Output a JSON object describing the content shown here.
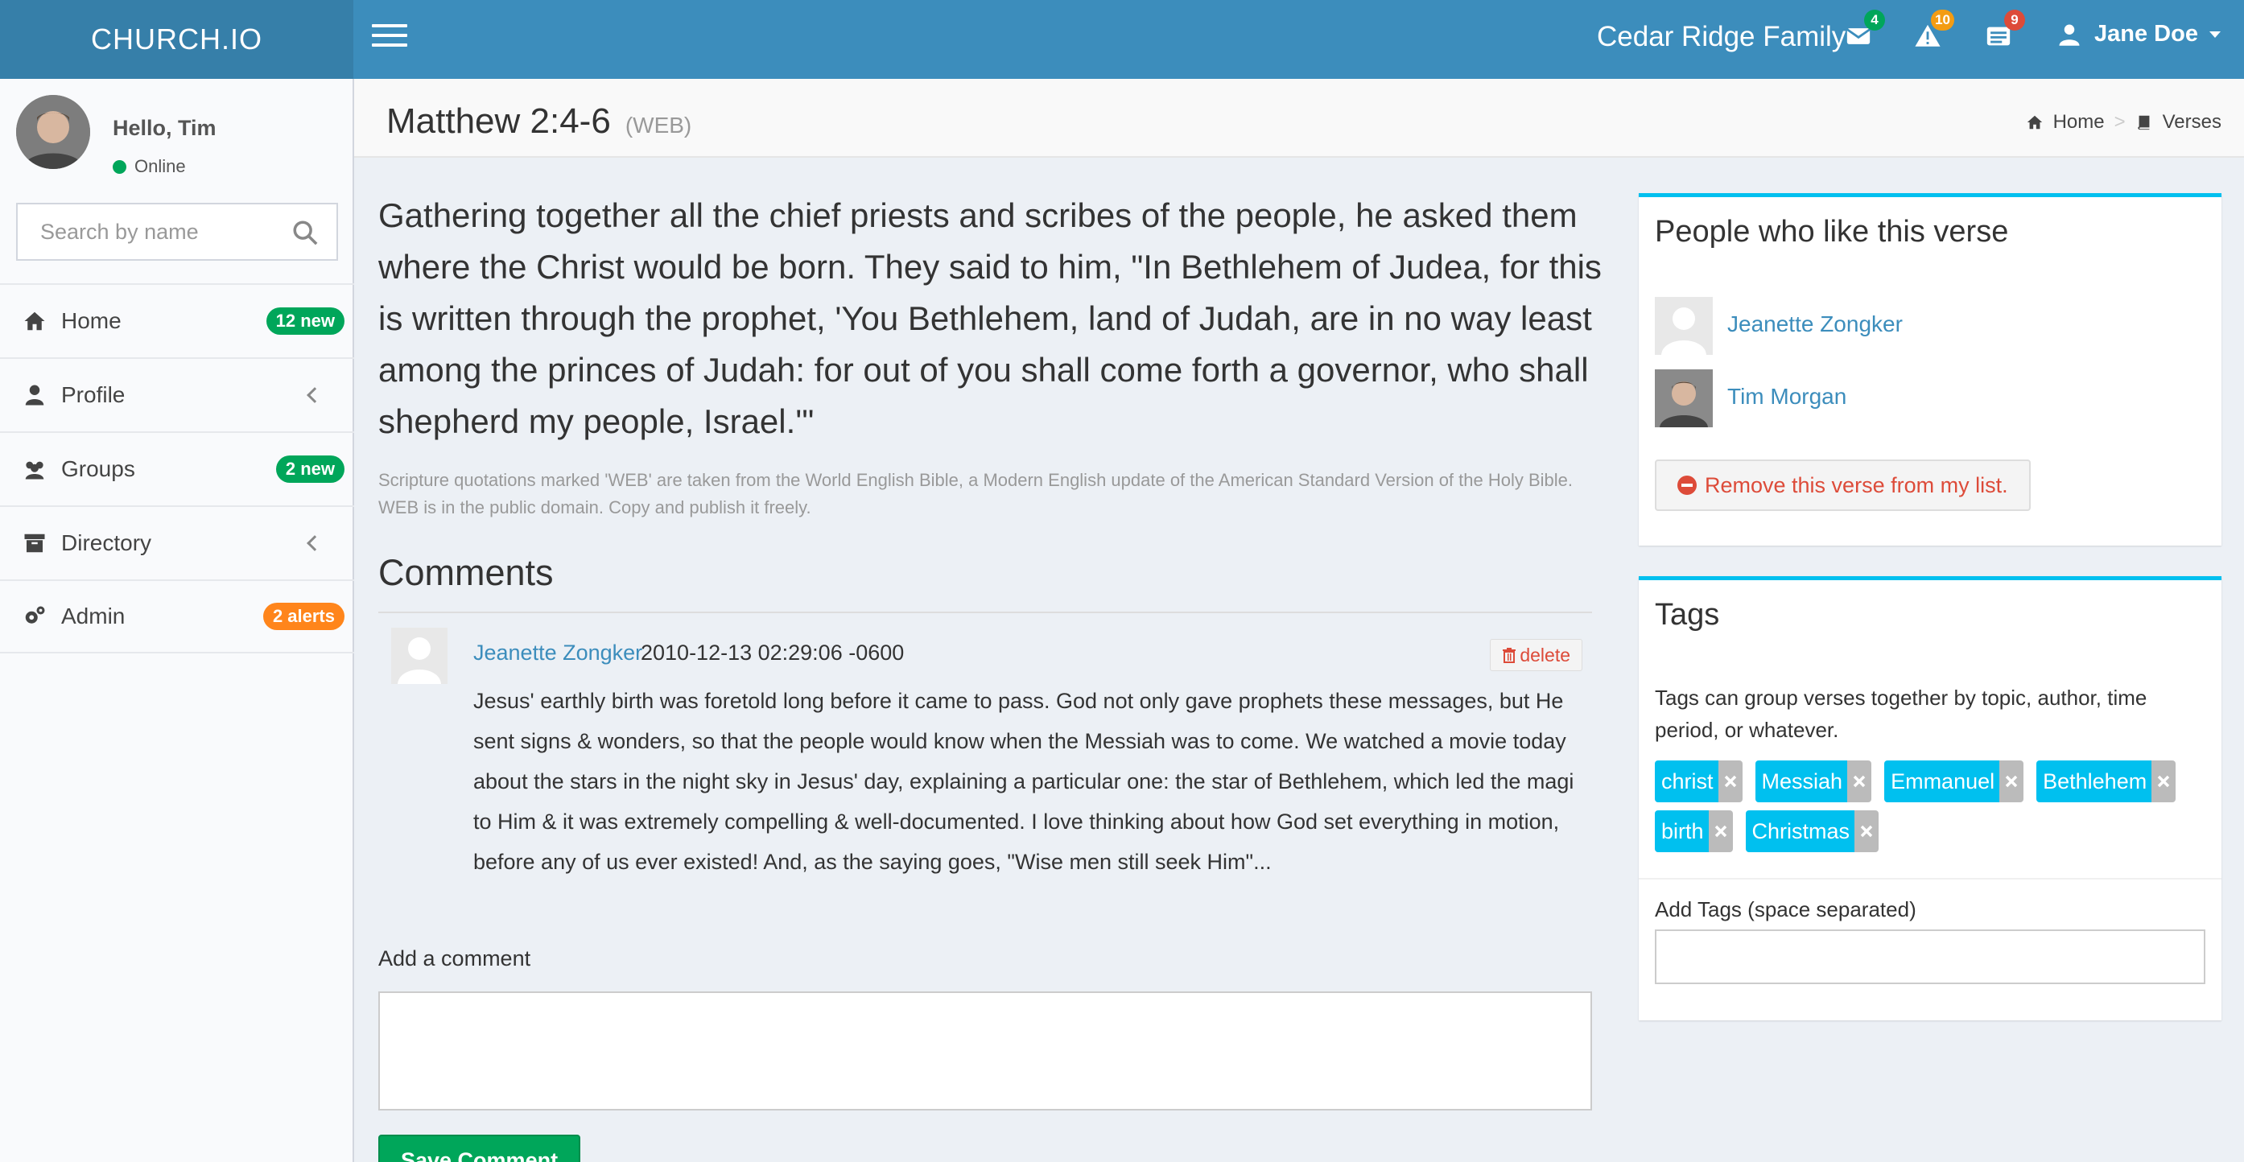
{
  "app": {
    "logo": "CHURCH.IO",
    "org_name": "Cedar Ridge Family",
    "user_name": "Jane Doe"
  },
  "notifications": [
    {
      "icon": "envelope-icon",
      "count": "4",
      "color": "#00a65a"
    },
    {
      "icon": "warning-icon",
      "count": "10",
      "color": "#f39c12"
    },
    {
      "icon": "list-icon",
      "count": "9",
      "color": "#dd4b39"
    }
  ],
  "sidebar": {
    "greeting": "Hello, Tim",
    "status": "Online",
    "search_placeholder": "Search by name",
    "items": [
      {
        "label": "Home",
        "icon": "home-icon",
        "badge": "12 new",
        "badge_color": "#00a65a"
      },
      {
        "label": "Profile",
        "icon": "user-icon",
        "badge": "",
        "has_submenu": true
      },
      {
        "label": "Groups",
        "icon": "users-icon",
        "badge": "2 new",
        "badge_color": "#00a65a"
      },
      {
        "label": "Directory",
        "icon": "archive-icon",
        "badge": "",
        "has_submenu": true
      },
      {
        "label": "Admin",
        "icon": "gears-icon",
        "badge": "2 alerts",
        "badge_color": "#ff851b"
      }
    ]
  },
  "header": {
    "title": "Matthew 2:4-6",
    "version": "(WEB)",
    "breadcrumb": [
      {
        "label": "Home",
        "icon": "home-icon"
      },
      {
        "label": "Verses",
        "icon": "book-icon"
      }
    ]
  },
  "verse": {
    "text": "Gathering together all the chief priests and scribes of the people, he asked them where the Christ would be born. They said to him, \"In Bethlehem of Judea, for this is written through the prophet, 'You Bethlehem, land of Judah, are in no way least among the princes of Judah: for out of you shall come forth a governor, who shall shepherd my people, Israel.'\"",
    "disclaimer": "Scripture quotations marked 'WEB' are taken from the World English Bible, a Modern English update of the American Standard Version of the Holy Bible. WEB is in the public domain. Copy and publish it freely."
  },
  "comments": {
    "title": "Comments",
    "items": [
      {
        "author": "Jeanette Zongker",
        "time": "2010-12-13 02:29:06 -0600",
        "delete_label": "delete",
        "body": "Jesus' earthly birth was foretold long before it came to pass. God not only gave prophets these messages, but He sent signs & wonders, so that the people would know when the Messiah was to come. We watched a movie today about the stars in the night sky in Jesus' day, explaining a particular one: the star of Bethlehem, which led the magi to Him & it was extremely compelling & well-documented. I love thinking about how God set everything in motion, before any of us ever existed! And, as the saying goes, \"Wise men still seek Him\"..."
      }
    ],
    "add_label": "Add a comment",
    "save_label": "Save Comment"
  },
  "likes": {
    "title": "People who like this verse",
    "people": [
      "Jeanette Zongker",
      "Tim Morgan"
    ],
    "remove_label": "Remove this verse from my list."
  },
  "tags": {
    "title": "Tags",
    "help": "Tags can group verses together by topic, author, time period, or whatever.",
    "items": [
      "christ",
      "Messiah",
      "Emmanuel",
      "Bethlehem",
      "birth",
      "Christmas"
    ],
    "add_label": "Add Tags (space separated)"
  },
  "colors": {
    "header": "#3c8dbc",
    "logo_bg": "#367fa9",
    "accent": "#00c0ef",
    "success": "#00a65a",
    "danger": "#dd4b39"
  }
}
